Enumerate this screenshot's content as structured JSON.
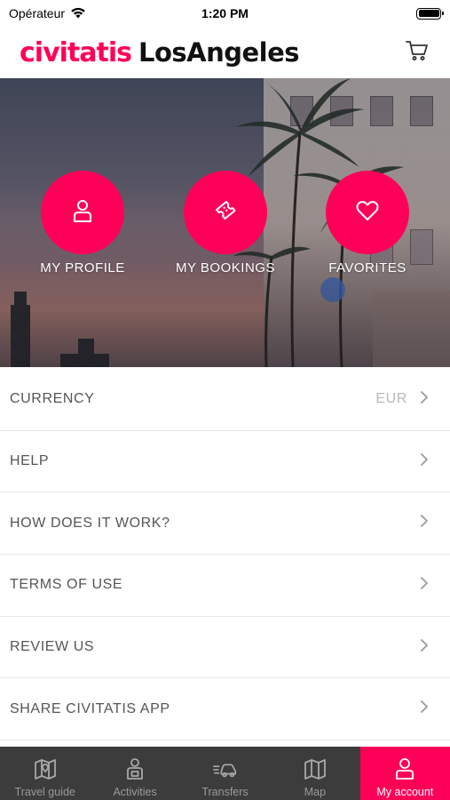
{
  "status_bar": {
    "carrier": "Opérateur",
    "time": "1:20 PM"
  },
  "header": {
    "brand": "civitatis",
    "city": "LosAngeles",
    "cart_icon": "cart-icon"
  },
  "colors": {
    "accent": "#ff0059",
    "tabbar": "#3c3c3c"
  },
  "hero": {
    "actions": [
      {
        "label": "MY PROFILE",
        "icon": "user-icon"
      },
      {
        "label": "MY BOOKINGS",
        "icon": "ticket-icon"
      },
      {
        "label": "FAVORITES",
        "icon": "heart-icon"
      }
    ]
  },
  "menu": {
    "items": [
      {
        "label": "CURRENCY",
        "value": "EUR"
      },
      {
        "label": "HELP",
        "value": ""
      },
      {
        "label": "HOW DOES IT WORK?",
        "value": ""
      },
      {
        "label": "TERMS OF USE",
        "value": ""
      },
      {
        "label": "REVIEW US",
        "value": ""
      },
      {
        "label": "SHARE CIVITATIS APP",
        "value": ""
      }
    ]
  },
  "tabbar": {
    "tabs": [
      {
        "label": "Travel guide",
        "icon": "map-pin-icon",
        "active": false
      },
      {
        "label": "Activities",
        "icon": "activities-icon",
        "active": false
      },
      {
        "label": "Transfers",
        "icon": "car-icon",
        "active": false
      },
      {
        "label": "Map",
        "icon": "map-icon",
        "active": false
      },
      {
        "label": "My account",
        "icon": "account-icon",
        "active": true
      }
    ]
  }
}
